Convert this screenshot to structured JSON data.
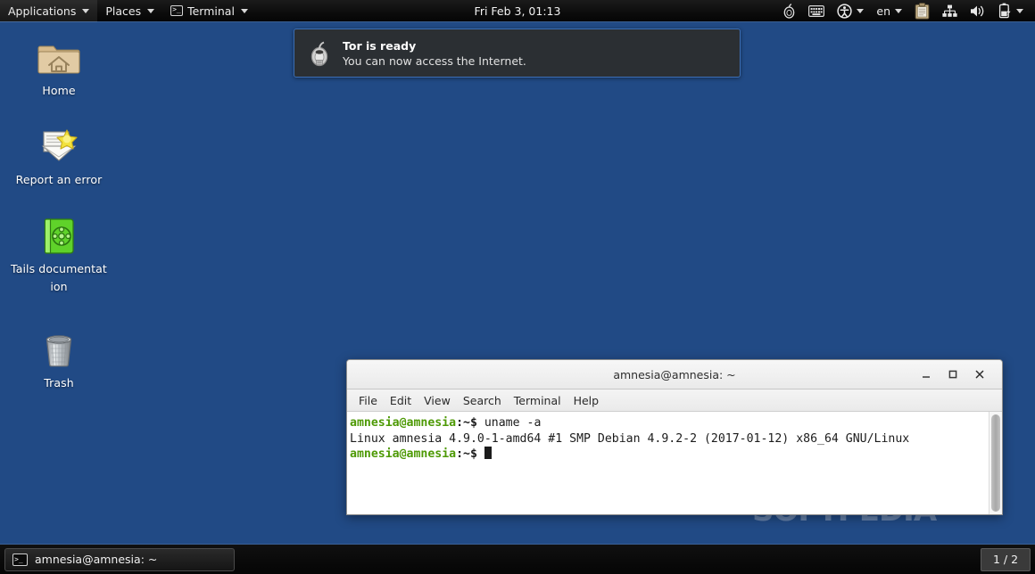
{
  "top_panel": {
    "applications_label": "Applications",
    "places_label": "Places",
    "terminal_label": "Terminal",
    "clock": "Fri Feb  3, 01:13",
    "language": "en",
    "tray_icons": [
      "tor-onion-icon",
      "keyboard-icon",
      "accessibility-icon",
      "keyboard-layout-icon",
      "clipboard-icon",
      "network-wired-icon",
      "volume-icon",
      "battery-charging-icon"
    ]
  },
  "desktop": {
    "background_color": "#214a85",
    "icons": [
      {
        "label": "Home",
        "icon": "home-folder-icon"
      },
      {
        "label": "Report an error",
        "icon": "report-error-icon"
      },
      {
        "label": "Tails documentation",
        "icon": "tails-documentation-icon"
      },
      {
        "label": "Trash",
        "icon": "trash-icon"
      }
    ]
  },
  "notification": {
    "icon": "tor-onion-icon",
    "title": "Tor is ready",
    "body": "You can now access the Internet.",
    "border_color": "#3c6fb5",
    "background_color": "#2b2f33"
  },
  "terminal": {
    "window_title": "amnesia@amnesia: ~",
    "controls": {
      "minimize_label": "–",
      "maximize_label": "□",
      "close_label": "×"
    },
    "menus": [
      "File",
      "Edit",
      "View",
      "Search",
      "Terminal",
      "Help"
    ],
    "lines": [
      {
        "prompt_user": "amnesia@amnesia",
        "prompt_path": ":~$",
        "command": " uname -a"
      },
      {
        "output": "Linux amnesia 4.9.0-1-amd64 #1 SMP Debian 4.9.2-2 (2017-01-12) x86_64 GNU/Linux"
      },
      {
        "prompt_user": "amnesia@amnesia",
        "prompt_path": ":~$",
        "command": " "
      }
    ],
    "prompt_user_color": "#4e9a06"
  },
  "watermark": {
    "text": "SOFTPEDIA"
  },
  "taskbar": {
    "task_label": "amnesia@amnesia: ~",
    "task_icon": "terminal-icon",
    "workspace_indicator": "1 / 2"
  }
}
